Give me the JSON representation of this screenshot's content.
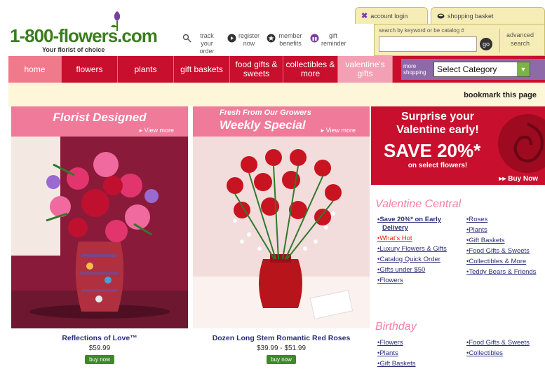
{
  "header": {
    "logo_text": "1-800-flowers.com",
    "tagline": "Your florist of choice",
    "quick_links": [
      {
        "label": "track your order",
        "icon": "magnifier-icon"
      },
      {
        "label": "register now",
        "icon": "arrow-icon"
      },
      {
        "label": "member benefits",
        "icon": "star-icon"
      },
      {
        "label": "gift reminder",
        "icon": "gift-icon"
      }
    ],
    "account_tab": "account login",
    "basket_tab": "shopping basket",
    "search_label": "search by keyword or be catalog #",
    "search_placeholder": "",
    "search_go": "go",
    "advanced_search": "advanced search"
  },
  "nav": {
    "tabs": [
      "home",
      "flowers",
      "plants",
      "gift baskets",
      "food gifts & sweets",
      "collectibles & more",
      "valentine's gifts"
    ],
    "more_shopping_label": "more shopping",
    "category_select": "Select Category"
  },
  "bookmark": "bookmark this page",
  "products": [
    {
      "header_line1": "Florist Designed",
      "header_line2": "",
      "view_more": "View more",
      "name": "Reflections of Love™",
      "price": "$59.99",
      "button": "buy now"
    },
    {
      "header_line1": "Fresh From Our Growers",
      "header_line2": "Weekly Special",
      "view_more": "View more",
      "name": "Dozen Long Stem Romantic Red Roses",
      "price": "$39.99 - $51.99",
      "button": "buy now"
    }
  ],
  "promo": {
    "line1": "Surprise your",
    "line2": "Valentine early!",
    "save": "SAVE 20%*",
    "sub": "on select flowers!",
    "buy": "Buy Now"
  },
  "valentine_central": {
    "title": "Valentine Central",
    "col1": [
      "Save 20%* on Early Delivery",
      "What's Hot",
      "Luxury Flowers & Gifts",
      "Catalog Quick Order",
      "Gifts under $50",
      "Flowers"
    ],
    "col2": [
      "Roses",
      "Plants",
      "Gift Baskets",
      "Food Gifts & Sweets",
      "Collectibles & More",
      "Teddy Bears & Friends"
    ]
  },
  "birthday": {
    "title": "Birthday",
    "col1": [
      "Flowers",
      "Plants",
      "Gift Baskets"
    ],
    "col2": [
      "Food Gifts & Sweets",
      "Collectibles"
    ]
  },
  "colors": {
    "brand_green": "#3b7d1e",
    "nav_red": "#c8102e",
    "panel_pink": "#f07a9a",
    "link_blue": "#2a2f7a",
    "hot_red": "#e0271c",
    "more_purple": "#8f6aa9"
  }
}
